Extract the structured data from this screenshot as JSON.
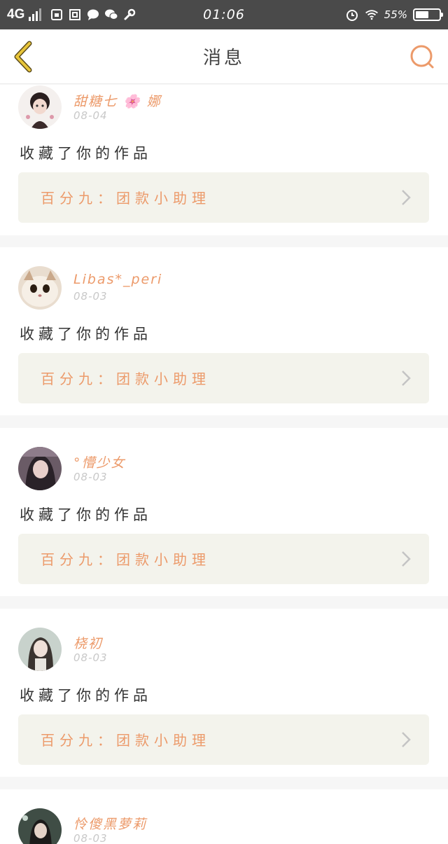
{
  "statusbar": {
    "network": "4G",
    "time": "01:06",
    "battery": "55%",
    "battery_level": 0.55,
    "icons": [
      "signal-bars-icon",
      "sim-icon",
      "message-icon",
      "wechat-icon",
      "wrench-icon",
      "alarm-icon",
      "wifi-icon",
      "battery-icon"
    ]
  },
  "header": {
    "title": "消息",
    "back_icon": "back-chevron-icon",
    "search_icon": "search-icon",
    "accent": "#ec9a6a",
    "back_color": "#e8c53a"
  },
  "messages": [
    {
      "name": "甜糖七 🌸 娜",
      "date": "08-04",
      "action": "收藏了你的作品",
      "work": "百分九：团款小助理"
    },
    {
      "name": "Libas*_peri",
      "date": "08-03",
      "action": "收藏了你的作品",
      "work": "百分九：团款小助理"
    },
    {
      "name": "°懵少女",
      "date": "08-03",
      "action": "收藏了你的作品",
      "work": "百分九：团款小助理"
    },
    {
      "name": "桡初",
      "date": "08-03",
      "action": "收藏了你的作品",
      "work": "百分九：团款小助理"
    },
    {
      "name": "怜傻黑萝莉",
      "date": "08-03"
    }
  ]
}
